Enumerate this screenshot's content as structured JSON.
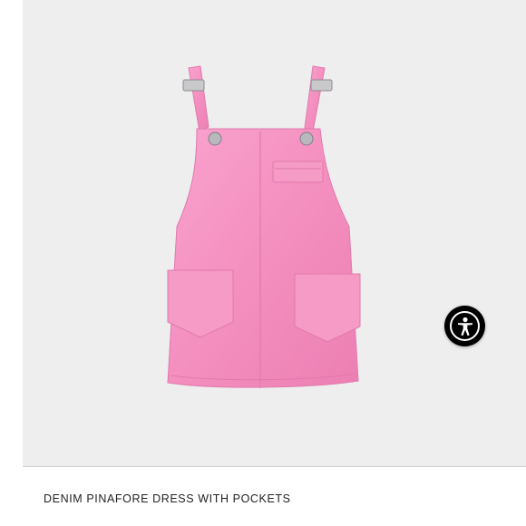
{
  "product": {
    "title": "DENIM PINAFORE DRESS WITH POCKETS",
    "image_icon": "pink-denim-pinafore-dress",
    "color": "#f48fbf"
  },
  "accessibility": {
    "icon": "accessibility-person-icon",
    "background": "#000000"
  },
  "page": {
    "background": "#eeeeee"
  }
}
